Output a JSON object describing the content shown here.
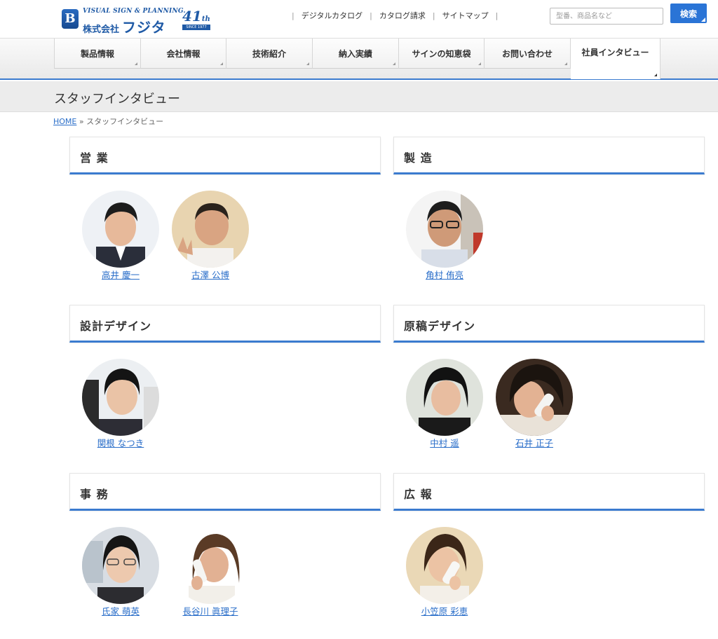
{
  "header": {
    "logo_en": "VISUAL SIGN & PLANNING.",
    "logo_company": "株式会社",
    "logo_name": "フジタ",
    "logo_badge": "B",
    "anniversary_num": "41",
    "anniversary_suffix": "th",
    "anniversary_since": "SINCE 1977",
    "links": [
      "デジタルカタログ",
      "カタログ請求",
      "サイトマップ"
    ],
    "search_placeholder": "型番、商品名など",
    "search_button": "検索"
  },
  "nav": {
    "items": [
      "製品情報",
      "会社情報",
      "技術紹介",
      "納入実績",
      "サインの知恵袋",
      "お問い合わせ",
      "社員インタビュー"
    ],
    "active_index": 6
  },
  "page": {
    "title": "スタッフインタビュー",
    "breadcrumb_home": "HOME",
    "breadcrumb_sep": "»",
    "breadcrumb_current": "スタッフインタビュー"
  },
  "sections": [
    {
      "title": "営 業",
      "people": [
        {
          "name": "高井 慶一"
        },
        {
          "name": "古澤 公博"
        }
      ]
    },
    {
      "title": "製 造",
      "people": [
        {
          "name": "角村 侑亮"
        }
      ]
    },
    {
      "title": "設計デザイン",
      "people": [
        {
          "name": "関根 なつき"
        }
      ]
    },
    {
      "title": "原稿デザイン",
      "people": [
        {
          "name": "中村 遥"
        },
        {
          "name": "石井 正子"
        }
      ]
    },
    {
      "title": "事 務",
      "people": [
        {
          "name": "氏家 萌英"
        },
        {
          "name": "長谷川 眞理子"
        }
      ]
    },
    {
      "title": "広 報",
      "people": [
        {
          "name": "小笠原 彩恵"
        }
      ]
    }
  ],
  "colors": {
    "accent": "#3b7bcf",
    "link": "#2a6ec9",
    "search_button": "#2a74d6"
  }
}
